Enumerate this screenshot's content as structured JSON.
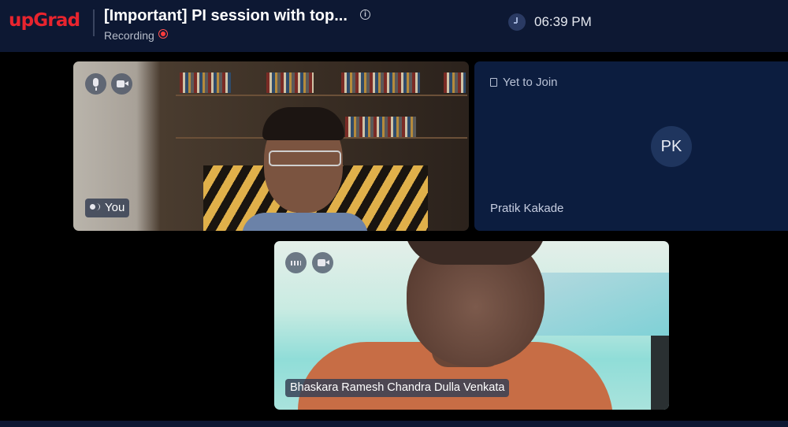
{
  "header": {
    "logo_text": "upGrad",
    "title": "[Important] PI session with top...",
    "recording_label": "Recording",
    "time": "06:39 PM"
  },
  "participants": [
    {
      "name_label": "You",
      "mic_icon": "mic-icon",
      "cam_icon": "video-icon"
    },
    {
      "status": "Yet to Join",
      "initials": "PK",
      "name": "Pratik Kakade"
    },
    {
      "name_label": "Bhaskara Ramesh Chandra Dulla Venkata",
      "audio_icon": "audio-wave-icon",
      "cam_icon": "video-icon"
    }
  ],
  "colors": {
    "brand": "#e8242e",
    "header_bg": "#0d1833",
    "tile_empty_bg": "#0c1d3f",
    "recording_red": "#ff3b3b"
  }
}
